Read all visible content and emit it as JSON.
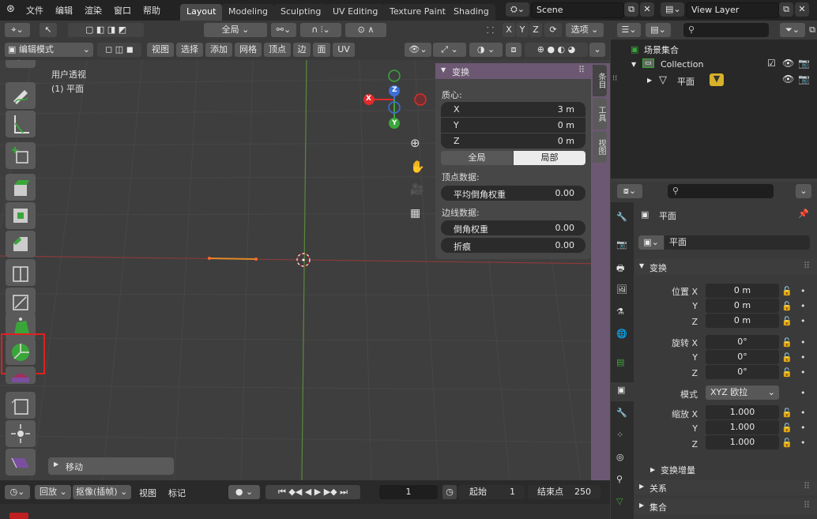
{
  "topbar": {
    "menus": [
      "文件",
      "编辑",
      "渲染",
      "窗口",
      "帮助"
    ],
    "workspace_tabs": [
      "Layout",
      "Modeling",
      "Sculpting",
      "UV Editing",
      "Texture Paint",
      "Shading"
    ],
    "active_tab": "Layout",
    "scene": "Scene",
    "view_layer": "View Layer"
  },
  "viewport_header": {
    "orientation": "全局",
    "options": "选项",
    "axes": [
      "X",
      "Y",
      "Z"
    ],
    "mode": "编辑模式",
    "menus": [
      "视图",
      "选择",
      "添加",
      "网格",
      "顶点",
      "边",
      "面",
      "UV"
    ]
  },
  "viewport": {
    "view_name": "用户透视",
    "object_name": "(1) 平面",
    "gizmo_axes": [
      "X",
      "Y",
      "Z"
    ],
    "last_op": "移动"
  },
  "npanel": {
    "header": "变换",
    "median_label": "质心:",
    "median": [
      {
        "label": "X",
        "value": "3 m"
      },
      {
        "label": "Y",
        "value": "0 m"
      },
      {
        "label": "Z",
        "value": "0 m"
      }
    ],
    "space_global": "全局",
    "space_local": "局部",
    "vertex_data_label": "顶点数据:",
    "vertex_bevel_label": "平均倒角权重",
    "vertex_bevel_value": "0.00",
    "edge_data_label": "边线数据:",
    "edge_bevel_label": "倒角权重",
    "edge_bevel_value": "0.00",
    "crease_label": "折痕",
    "crease_value": "0.00",
    "tabs": [
      "条目",
      "工具",
      "视图"
    ]
  },
  "outliner": {
    "root": "场景集合",
    "collection": "Collection",
    "object": "平面"
  },
  "properties": {
    "object_name": "平面",
    "data_name": "平面",
    "transform_header": "变换",
    "location_label": "位置",
    "location": [
      {
        "axis": "X",
        "value": "0 m"
      },
      {
        "axis": "Y",
        "value": "0 m"
      },
      {
        "axis": "Z",
        "value": "0 m"
      }
    ],
    "rotation_label": "旋转",
    "rotation": [
      {
        "axis": "X",
        "value": "0°"
      },
      {
        "axis": "Y",
        "value": "0°"
      },
      {
        "axis": "Z",
        "value": "0°"
      }
    ],
    "mode_label": "模式",
    "mode_value": "XYZ 欧拉",
    "scale_label": "缩放",
    "scale": [
      {
        "axis": "X",
        "value": "1.000"
      },
      {
        "axis": "Y",
        "value": "1.000"
      },
      {
        "axis": "Z",
        "value": "1.000"
      }
    ],
    "delta_transform": "变换增量",
    "relations": "关系",
    "collections": "集合"
  },
  "timeline": {
    "playback": "回放",
    "keying": "抠像(插帧)",
    "view": "视图",
    "marker": "标记",
    "current_frame": "1",
    "start_label": "起始",
    "start_value": "1",
    "end_label": "结束点",
    "end_value": "250"
  },
  "colors": {
    "accent_tab_bg": "#4a4a4a",
    "npanel_header": "#6d5873",
    "highlight_box": "#e02020",
    "gizmo_x": "#e22a2a",
    "gizmo_y": "#3aa63a",
    "gizmo_z": "#3c6fd6"
  }
}
